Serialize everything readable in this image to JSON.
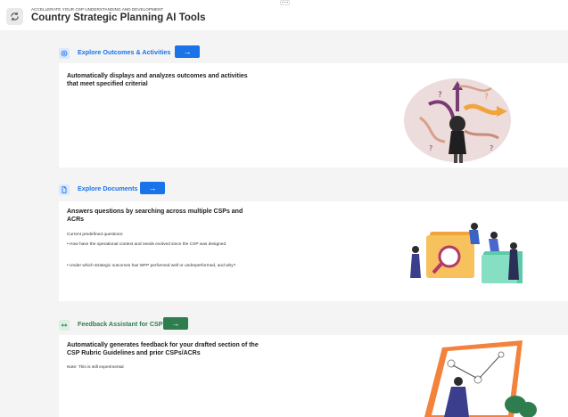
{
  "header": {
    "kicker": "ACCELLERATE YOUR CSP UNDERSTANDING AND DEVELOPMENT",
    "title": "Country Strategic Planning AI Tools",
    "more_label": "···",
    "app_icon": "refresh-icon"
  },
  "sections": [
    {
      "title": "Explore Outcomes & Activities",
      "button_label": "→",
      "icon": "target-icon",
      "accent": "#1a73e8",
      "card_title": "Automatically displays and analyzes outcomes and activities that meet specified criterial",
      "lines": []
    },
    {
      "title": "Explore Documents",
      "button_label": "→",
      "icon": "document-icon",
      "accent": "#1a73e8",
      "card_title": "Answers questions by searching across multiple CSPs and ACRs",
      "lines": [
        "Current predefined questions:",
        "• How have the operational context and needs evolved since the CSP was designed",
        "• Under which strategic outcomes has WFP performed well or underperformed, and why?"
      ]
    },
    {
      "title": "Feedback Assistant for CSP",
      "button_label": "→",
      "icon": "swap-arrows-icon",
      "accent": "#2e7d4f",
      "card_title": "Automatically generates feedback for your drafted section of the CSP Rubric Guidelines and prior CSPs/ACRs",
      "lines": [
        "Note: This is still experimental"
      ]
    }
  ]
}
